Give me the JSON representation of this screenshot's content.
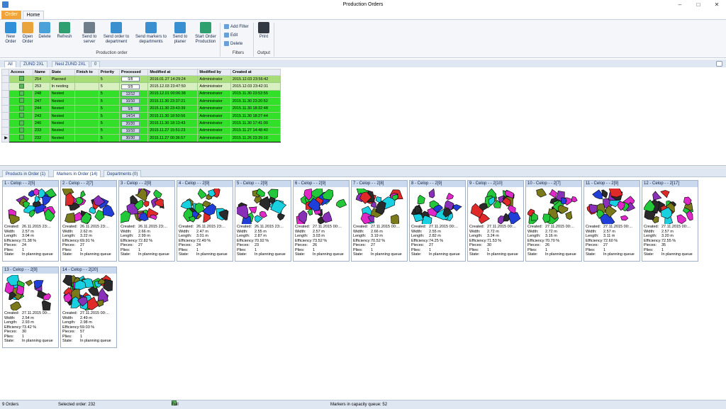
{
  "window": {
    "title": "Production Orders"
  },
  "ribbon_tabs": [
    "Order",
    "Home"
  ],
  "ribbon": {
    "buttons": [
      {
        "label": "New Order",
        "color": "#2f8fd9"
      },
      {
        "label": "Open Order",
        "color": "#e8a33a"
      },
      {
        "label": "Delete",
        "color": "#4aa0d8"
      },
      {
        "label": "Refresh",
        "color": "#2f9f6f"
      },
      {
        "label": "Send to server",
        "color": "#6f7c8a"
      },
      {
        "label": "Send order to department",
        "color": "#3a8fd0"
      },
      {
        "label": "Send markers to departments",
        "color": "#3a8fd0"
      },
      {
        "label": "Send to planer",
        "color": "#3a8fd0"
      },
      {
        "label": "Start Order Production",
        "color": "#2f9f6f"
      }
    ],
    "group_production": "Production order",
    "filter_buttons": [
      "Add Filter",
      "Edit",
      "Delete"
    ],
    "group_filters": "Filters",
    "print_label": "Print",
    "group_output": "Output"
  },
  "order_tabs": [
    "All",
    "ZUND 2XL",
    "Nest ZUND 2XL",
    "0"
  ],
  "grid": {
    "columns": [
      "",
      "Access",
      "Name",
      "State",
      "Finish to",
      "Priority",
      "Processed",
      "Modified at",
      "Modified by",
      "Created at"
    ],
    "rows": [
      {
        "name": "254",
        "state": "Planned",
        "finish": "",
        "priority": "5",
        "processed": "0/8",
        "modified": "2016.01.27 14:29:24",
        "by": "Administrator",
        "created": "2015.12.03 23:56:42",
        "style": "planned"
      },
      {
        "name": "253",
        "state": "In nesting",
        "finish": "",
        "priority": "5",
        "processed": "0/9",
        "modified": "2015.12.03 23:47:50",
        "by": "Administrator",
        "created": "2015.12.03 23:42:31",
        "style": "nesting"
      },
      {
        "name": "248",
        "state": "Nested",
        "finish": "",
        "priority": "5",
        "processed": "12/12",
        "modified": "2015.12.01 00:06:38",
        "by": "Administrator",
        "created": "2015.11.30 23:53:55",
        "style": "nested"
      },
      {
        "name": "247",
        "state": "Nested",
        "finish": "",
        "priority": "5",
        "processed": "10/10",
        "modified": "2015.11.30 23:37:21",
        "by": "Administrator",
        "created": "2015.11.30 23:20:52",
        "style": "nested"
      },
      {
        "name": "244",
        "state": "Nested",
        "finish": "",
        "priority": "5",
        "processed": "5/5",
        "modified": "2015.11.30 23:43:39",
        "by": "Administrator",
        "created": "2015.11.30 18:32:48",
        "style": "nested"
      },
      {
        "name": "243",
        "state": "Nested",
        "finish": "",
        "priority": "5",
        "processed": "14/14",
        "modified": "2015.11.30 18:50:56",
        "by": "Administrator",
        "created": "2015.11.30 18:27:44",
        "style": "nested"
      },
      {
        "name": "240",
        "state": "Nested",
        "finish": "",
        "priority": "5",
        "processed": "20/20",
        "modified": "2015.11.30 18:13:43",
        "by": "Administrator",
        "created": "2015.11.30 17:41:00",
        "style": "nested"
      },
      {
        "name": "233",
        "state": "Nested",
        "finish": "",
        "priority": "5",
        "processed": "10/10",
        "modified": "2015.11.27 15:51:23",
        "by": "Administrator",
        "created": "2015.11.27 14:48:40",
        "style": "nested"
      },
      {
        "name": "232",
        "state": "Nested",
        "finish": "",
        "priority": "5",
        "processed": "30/30",
        "modified": "2015.11.27 00:36:57",
        "by": "Administrator",
        "created": "2015.11.26 23:39:16",
        "style": "nested"
      }
    ]
  },
  "bottom_tabs": [
    "Products in Order (1)",
    "Markers in Order (14)",
    "Departments (0)"
  ],
  "marker_labels": {
    "created": "Created:",
    "width": "Width:",
    "length": "Length:",
    "efficiency": "Efficiency:",
    "pieces": "Pieces:",
    "plies": "Plies:",
    "state": "State:"
  },
  "markers": [
    {
      "title": "1 - Celop - - 2[5]",
      "created": "26.11.2015 23:...",
      "width": "2.57 m",
      "length": "3.04 m",
      "efficiency": "71.38 %",
      "pieces": "24",
      "plies": "1",
      "state": "In planning queue"
    },
    {
      "title": "2 - Celop - - 2[7]",
      "created": "26.11.2015 23:...",
      "width": "2.62 m",
      "length": "3.22 m",
      "efficiency": "69.91 %",
      "pieces": "27",
      "plies": "1",
      "state": "In planning queue"
    },
    {
      "title": "3 - Celop - - 2[9]",
      "created": "26.11.2015 23:...",
      "width": "2.66 m",
      "length": "2.99 m",
      "efficiency": "72.82 %",
      "pieces": "27",
      "plies": "1",
      "state": "In planning queue"
    },
    {
      "title": "4 - Celop - - 2[9]",
      "created": "26.11.2015 23:...",
      "width": "2.47 m",
      "length": "3.01 m",
      "efficiency": "72.49 %",
      "pieces": "24",
      "plies": "1",
      "state": "In planning queue"
    },
    {
      "title": "5 - Celop - - 2[9]",
      "created": "26.11.2015 23:...",
      "width": "2.55 m",
      "length": "2.87 m",
      "efficiency": "70.92 %",
      "pieces": "23",
      "plies": "1",
      "state": "In planning queue"
    },
    {
      "title": "6 - Celop - - 2[9]",
      "created": "27.11.2015 00:...",
      "width": "2.57 m",
      "length": "3.03 m",
      "efficiency": "73.52 %",
      "pieces": "26",
      "plies": "1",
      "state": "In planning queue"
    },
    {
      "title": "7 - Celop - - 2[8]",
      "created": "27.11.2015 00:...",
      "width": "2.66 m",
      "length": "3.19 m",
      "efficiency": "70.52 %",
      "pieces": "27",
      "plies": "1",
      "state": "In planning queue"
    },
    {
      "title": "8 - Celop - - 2[9]",
      "created": "27.11.2015 00:...",
      "width": "2.55 m",
      "length": "2.82 m",
      "efficiency": "74.25 %",
      "pieces": "27",
      "plies": "1",
      "state": "In planning queue"
    },
    {
      "title": "9 - Celop - - 2[10]",
      "created": "27.11.2015 00:...",
      "width": "2.72 m",
      "length": "3.24 m",
      "efficiency": "71.53 %",
      "pieces": "30",
      "plies": "1",
      "state": "In planning queue"
    },
    {
      "title": "10 - Celop - - 2[7]",
      "created": "27.11.2015 00:...",
      "width": "2.72 m",
      "length": "3.16 m",
      "efficiency": "70.70 %",
      "pieces": "26",
      "plies": "1",
      "state": "In planning queue"
    },
    {
      "title": "11 - Celop - - 2[9]",
      "created": "27.11.2015 00:...",
      "width": "2.57 m",
      "length": "3.11 m",
      "efficiency": "72.60 %",
      "pieces": "27",
      "plies": "1",
      "state": "In planning queue"
    },
    {
      "title": "12 - Celop - - 2[17]",
      "created": "27.11.2015 00:...",
      "width": "2.57 m",
      "length": "3.20 m",
      "efficiency": "72.55 %",
      "pieces": "35",
      "plies": "1",
      "state": "In planning queue"
    },
    {
      "title": "13 - Celop - - 2[9]",
      "created": "27.11.2015 00:...",
      "width": "2.54 m",
      "length": "2.93 m",
      "efficiency": "73.42 %",
      "pieces": "30",
      "plies": "1",
      "state": "In planning queue"
    },
    {
      "title": "14 - Celop - - 2[20]",
      "created": "27.11.2015 00:...",
      "width": "2.49 m",
      "length": "2.98 m",
      "efficiency": "59.03 %",
      "pieces": "57",
      "plies": "1",
      "state": "In planning queue"
    }
  ],
  "piece_colors": [
    "#1f3fd8",
    "#22c83a",
    "#e02a2a",
    "#8a2fb8",
    "#18d0e0",
    "#7a7a1a",
    "#e028c8",
    "#2a2a2a"
  ],
  "statusbar": {
    "orders": "9 Orders",
    "selected": "Selected order: 232",
    "access": "Full access to file",
    "queue": "Markers in capacity queue: 52"
  }
}
